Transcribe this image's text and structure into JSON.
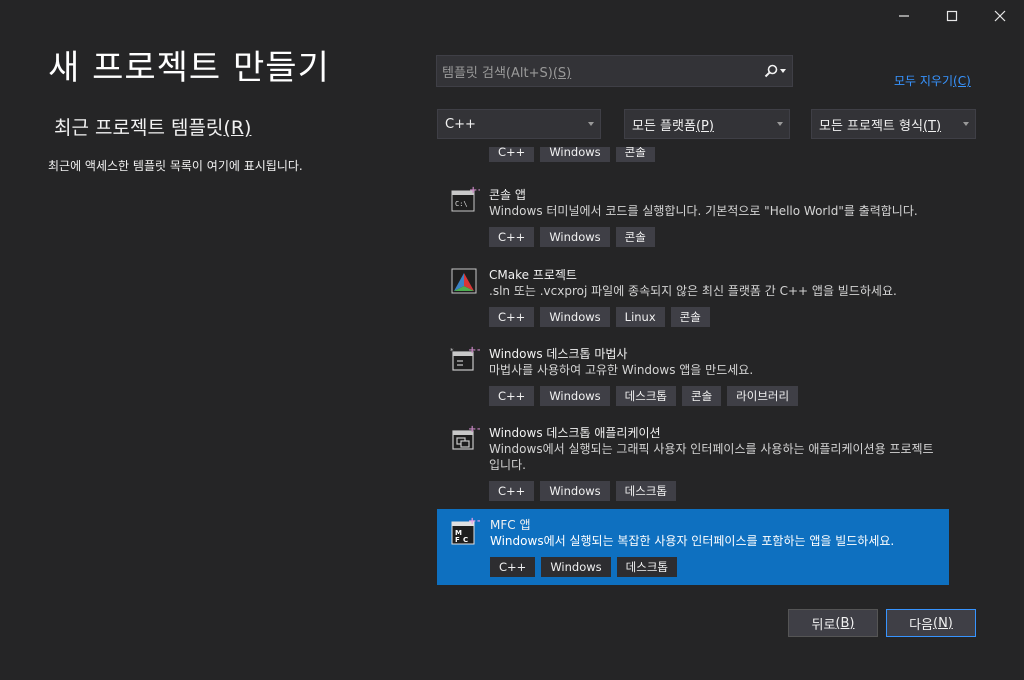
{
  "title": "새 프로젝트 만들기",
  "recent": {
    "heading": "최근 프로젝트 템플릿",
    "heading_mnemonic": "(R)",
    "empty_text": "최근에 액세스한 템플릿 목록이 여기에 표시됩니다."
  },
  "search": {
    "placeholder": "템플릿 검색(Alt+S)",
    "placeholder_mnemonic": "(S)",
    "icon": "search-icon"
  },
  "clear_all": {
    "label": "모두 지우기",
    "mnemonic": "(C)"
  },
  "filters": {
    "language": "C++",
    "platform": "모든 플랫폼",
    "platform_mnemonic": "(P)",
    "project_type": "모든 프로젝트 형식",
    "project_type_mnemonic": "(T)"
  },
  "partial_top_tags": [
    "C++",
    "Windows",
    "콘솔"
  ],
  "templates": [
    {
      "name": "콘솔 앱",
      "desc": "Windows 터미널에서 코드를 실행합니다. 기본적으로 \"Hello World\"를 출력합니다.",
      "tags": [
        "C++",
        "Windows",
        "콘솔"
      ],
      "icon": "console-app-icon",
      "selected": false
    },
    {
      "name": "CMake 프로젝트",
      "desc": ".sln 또는 .vcxproj 파일에 종속되지 않은 최신 플랫폼 간 C++ 앱을 빌드하세요.",
      "tags": [
        "C++",
        "Windows",
        "Linux",
        "콘솔"
      ],
      "icon": "cmake-icon",
      "selected": false
    },
    {
      "name": "Windows 데스크톱 마법사",
      "desc": "마법사를 사용하여 고유한 Windows 앱을 만드세요.",
      "tags": [
        "C++",
        "Windows",
        "데스크톱",
        "콘솔",
        "라이브러리"
      ],
      "icon": "desktop-wizard-icon",
      "selected": false
    },
    {
      "name": "Windows 데스크톱 애플리케이션",
      "desc": "Windows에서 실행되는 그래픽 사용자 인터페이스를 사용하는 애플리케이션용 프로젝트입니다.",
      "tags": [
        "C++",
        "Windows",
        "데스크톱"
      ],
      "icon": "desktop-app-icon",
      "selected": false
    },
    {
      "name": "MFC 앱",
      "desc": "Windows에서 실행되는 복잡한 사용자 인터페이스를 포함하는 앱을 빌드하세요.",
      "tags": [
        "C++",
        "Windows",
        "데스크톱"
      ],
      "icon": "mfc-icon",
      "selected": true
    }
  ],
  "buttons": {
    "back": "뒤로",
    "back_mnemonic": "(B)",
    "next": "다음",
    "next_mnemonic": "(N)"
  },
  "colors": {
    "background": "#252526",
    "accent": "#0e70c0",
    "link": "#3794ff"
  }
}
